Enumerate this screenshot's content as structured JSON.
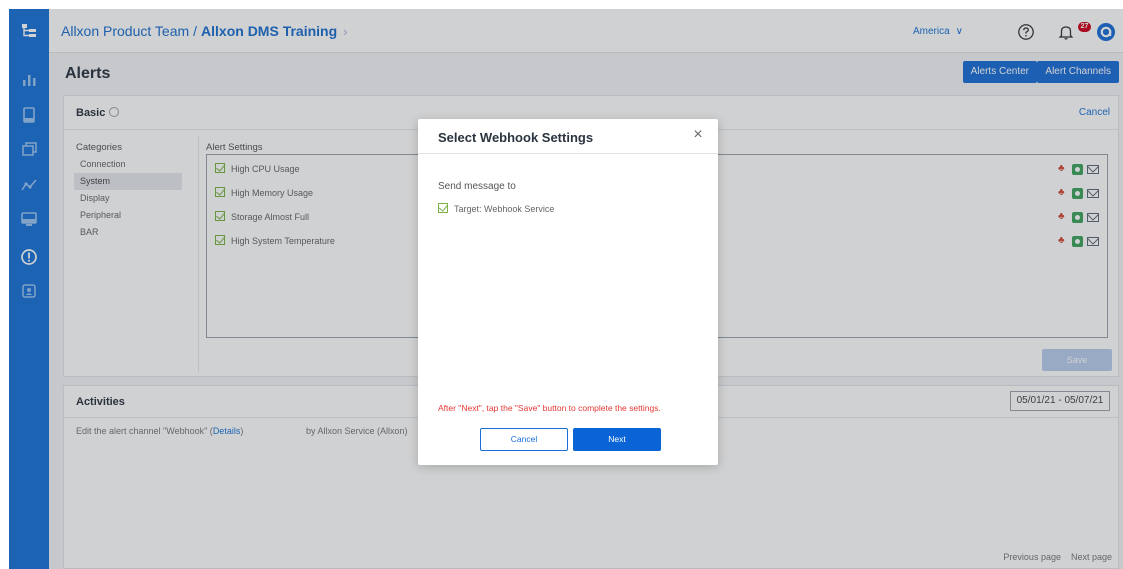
{
  "topbar": {
    "team": "Allxon Product Team",
    "separator": "/",
    "project": "Allxon DMS Training",
    "chevron": "›",
    "region": "America",
    "region_caret": "∨",
    "notification_count": "27"
  },
  "page": {
    "title": "Alerts",
    "alerts_center_label": "Alerts Center",
    "alert_channels_label": "Alert Channels"
  },
  "basic": {
    "title": "Basic",
    "cancel_label": "Cancel",
    "categories_title": "Categories",
    "categories": [
      "Connection",
      "System",
      "Display",
      "Peripheral",
      "BAR"
    ],
    "selected_category": "System",
    "alert_settings_title": "Alert Settings",
    "alert_settings": [
      "High CPU Usage",
      "High Memory Usage",
      "Storage Almost Full",
      "High System Temperature"
    ],
    "save_label": "Save"
  },
  "activities": {
    "title": "Activities",
    "date_range": "05/01/21 - 05/07/21",
    "row_text": "Edit the alert channel \"Webhook\" (",
    "row_link": "Details",
    "row_close": ")",
    "row_by": "by Allxon Service (Allxon)",
    "previous_page": "Previous page",
    "next_page": "Next page"
  },
  "modal": {
    "title": "Select Webhook Settings",
    "close_glyph": "×",
    "send_label": "Send message to",
    "target_label": "Target: Webhook Service",
    "hint": "After \"Next\", tap the \"Save\" button to complete the settings.",
    "cancel_label": "Cancel",
    "next_label": "Next"
  },
  "colors": {
    "sidebar": "#1a73d9",
    "primary_button": "#0a64d6",
    "check_green": "#7cb342",
    "hint_red": "#e53935"
  },
  "icons": {
    "sidebar": [
      "hierarchy-icon",
      "bar-chart-icon",
      "device-icon",
      "layers-icon",
      "network-icon",
      "monitor-icon",
      "alert-icon",
      "user-badge-icon"
    ],
    "topbar": [
      "help-icon",
      "bell-icon",
      "account-icon"
    ]
  }
}
